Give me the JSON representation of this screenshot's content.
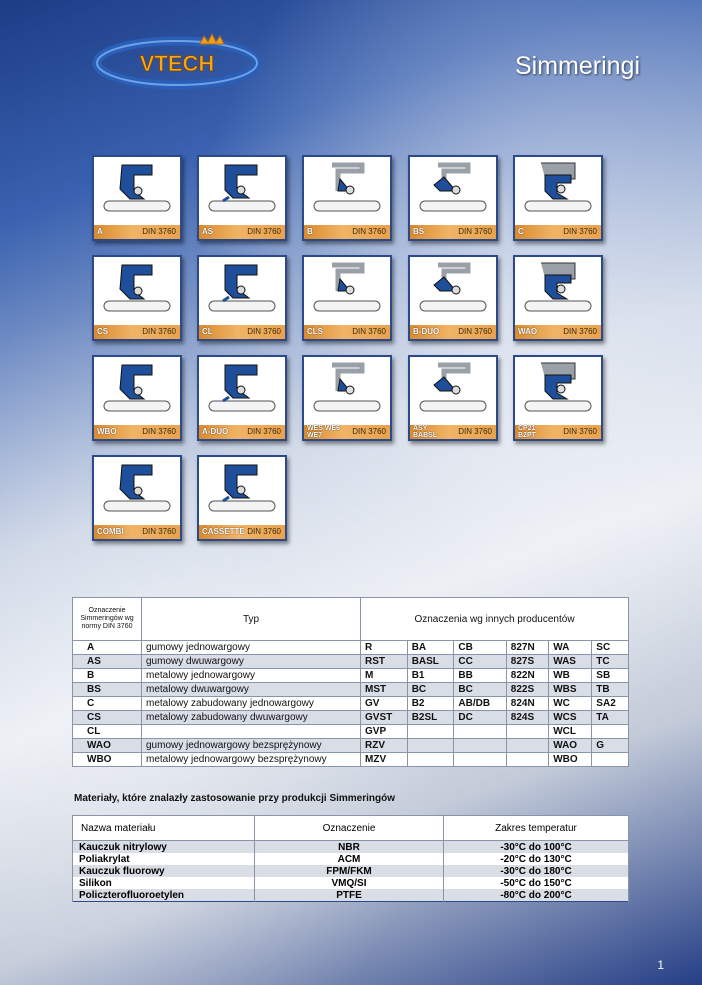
{
  "logo": {
    "text": "VTECH"
  },
  "page": {
    "title": "Simmeringi",
    "number": "1"
  },
  "tiles": [
    {
      "code": "A",
      "din": "DIN 3760"
    },
    {
      "code": "AS",
      "din": "DIN 3760"
    },
    {
      "code": "B",
      "din": "DIN 3760"
    },
    {
      "code": "BS",
      "din": "DIN 3760"
    },
    {
      "code": "C",
      "din": "DIN 3760"
    },
    {
      "code": "CS",
      "din": "DIN 3760"
    },
    {
      "code": "CL",
      "din": "DIN 3760"
    },
    {
      "code": "CLS",
      "din": "DIN 3760"
    },
    {
      "code": "B-DUO",
      "din": "DIN 3760"
    },
    {
      "code": "WAO",
      "din": "DIN 3760"
    },
    {
      "code": "WBO",
      "din": "DIN 3760"
    },
    {
      "code": "A-DUO",
      "din": "DIN 3760"
    },
    {
      "code": "WES WE6\nWE7",
      "din": "DIN 3760"
    },
    {
      "code": "ASY\nBABSL",
      "din": "DIN 3760"
    },
    {
      "code": "CP21\nB2PT",
      "din": "DIN 3760"
    },
    {
      "code": "COMBI",
      "din": "DIN 3760"
    },
    {
      "code": "CASSETTE",
      "din": "DIN 3760"
    }
  ],
  "seal_table": {
    "headers": {
      "col1": "Oznaczenie Simmeringów wg normy DIN 3760",
      "col2": "Typ",
      "col3": "Oznaczenia wg innych producentów"
    },
    "rows": [
      {
        "code": "A",
        "type": "gumowy jednowargowy",
        "m1": "R",
        "m2": "BA",
        "m3": "CB",
        "m4": "827N",
        "m5": "WA",
        "m6": "SC"
      },
      {
        "code": "AS",
        "type": "gumowy dwuwargowy",
        "m1": "RST",
        "m2": "BASL",
        "m3": "CC",
        "m4": "827S",
        "m5": "WAS",
        "m6": "TC"
      },
      {
        "code": "B",
        "type": "metalowy jednowargowy",
        "m1": "M",
        "m2": "B1",
        "m3": "BB",
        "m4": "822N",
        "m5": "WB",
        "m6": "SB"
      },
      {
        "code": "BS",
        "type": "metalowy dwuwargowy",
        "m1": "MST",
        "m2": "BC",
        "m3": "BC",
        "m4": "822S",
        "m5": "WBS",
        "m6": "TB"
      },
      {
        "code": "C",
        "type": "metalowy zabudowany jednowargowy",
        "m1": "GV",
        "m2": "B2",
        "m3": "AB/DB",
        "m4": "824N",
        "m5": "WC",
        "m6": "SA2"
      },
      {
        "code": "CS",
        "type": "metalowy zabudowany dwuwargowy",
        "m1": "GVST",
        "m2": "B2SL",
        "m3": "DC",
        "m4": "824S",
        "m5": "WCS",
        "m6": "TA"
      },
      {
        "code": "CL",
        "type": "",
        "m1": "GVP",
        "m2": "",
        "m3": "",
        "m4": "",
        "m5": "WCL",
        "m6": ""
      },
      {
        "code": "WAO",
        "type": "gumowy jednowargowy bezsprężynowy",
        "m1": "RZV",
        "m2": "",
        "m3": "",
        "m4": "",
        "m5": "WAO",
        "m6": "G"
      },
      {
        "code": "WBO",
        "type": "metalowy jednowargowy bezsprężynowy",
        "m1": "MZV",
        "m2": "",
        "m3": "",
        "m4": "",
        "m5": "WBO",
        "m6": ""
      }
    ]
  },
  "materials": {
    "heading": "Materiały, które znalazły zastosowanie przy produkcji Simmeringów",
    "headers": {
      "name": "Nazwa materiału",
      "code": "Oznaczenie",
      "temp": "Zakres temperatur"
    },
    "rows": [
      {
        "name": "Kauczuk nitrylowy",
        "code": "NBR",
        "temp": "-30°C do 100°C"
      },
      {
        "name": "Poliakrylat",
        "code": "ACM",
        "temp": "-20°C do 130°C"
      },
      {
        "name": "Kauczuk fluorowy",
        "code": "FPM/FKM",
        "temp": "-30°C do 180°C"
      },
      {
        "name": "Silikon",
        "code": "VMQ/SI",
        "temp": "-50°C do 150°C"
      },
      {
        "name": "Policzterofluoroetylen",
        "code": "PTFE",
        "temp": "-80°C do 200°C"
      }
    ]
  },
  "colors": {
    "seal_blue": "#1f4e9a",
    "metal_grey": "#9aa0a8",
    "caption_orange": "#e9a24c"
  }
}
